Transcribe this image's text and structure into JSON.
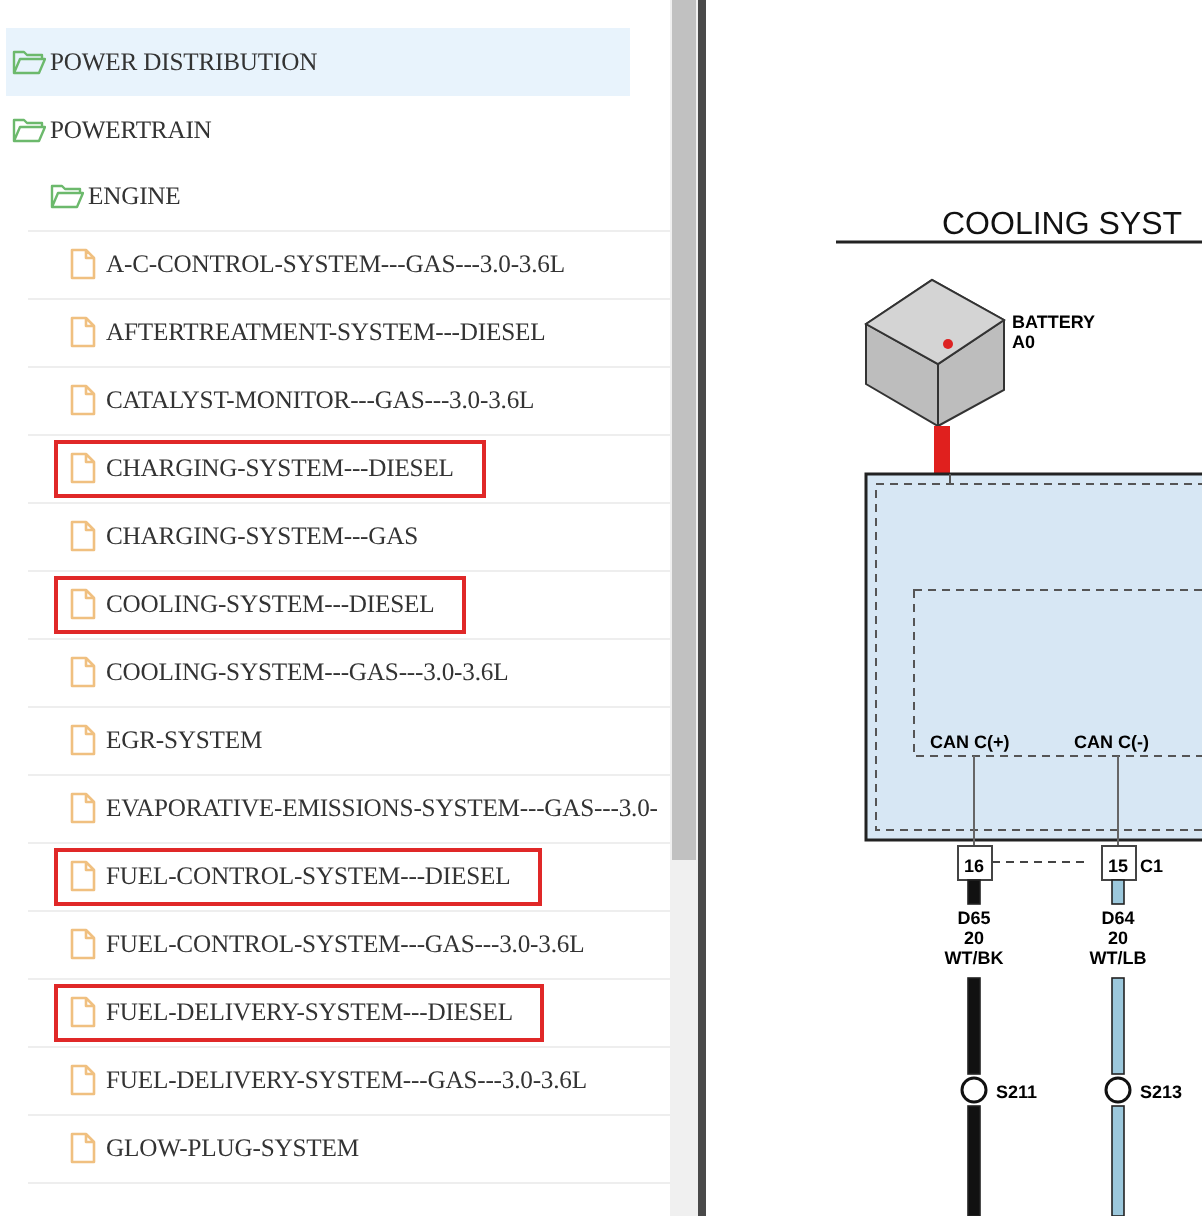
{
  "tree": [
    {
      "kind": "folder",
      "label": "POWER DISTRIBUTION",
      "selected": true
    },
    {
      "kind": "folder",
      "label": "POWERTRAIN",
      "selected": false,
      "children": [
        {
          "kind": "folder",
          "label": "ENGINE",
          "selected": false,
          "children": [
            {
              "kind": "file",
              "label": "A-C-CONTROL-SYSTEM---GAS---3.0-3.6L",
              "selected": false,
              "flagged": false
            },
            {
              "kind": "file",
              "label": "AFTERTREATMENT-SYSTEM---DIESEL",
              "selected": false,
              "flagged": false
            },
            {
              "kind": "file",
              "label": "CATALYST-MONITOR---GAS---3.0-3.6L",
              "selected": false,
              "flagged": false
            },
            {
              "kind": "file",
              "label": "CHARGING-SYSTEM---DIESEL",
              "selected": false,
              "flagged": true
            },
            {
              "kind": "file",
              "label": "CHARGING-SYSTEM---GAS",
              "selected": false,
              "flagged": false
            },
            {
              "kind": "file",
              "label": "COOLING-SYSTEM---DIESEL",
              "selected": false,
              "flagged": true
            },
            {
              "kind": "file",
              "label": "COOLING-SYSTEM---GAS---3.0-3.6L",
              "selected": false,
              "flagged": false
            },
            {
              "kind": "file",
              "label": "EGR-SYSTEM",
              "selected": false,
              "flagged": false
            },
            {
              "kind": "file",
              "label": "EVAPORATIVE-EMISSIONS-SYSTEM---GAS---3.0-",
              "selected": false,
              "flagged": false
            },
            {
              "kind": "file",
              "label": "FUEL-CONTROL-SYSTEM---DIESEL",
              "selected": false,
              "flagged": true
            },
            {
              "kind": "file",
              "label": "FUEL-CONTROL-SYSTEM---GAS---3.0-3.6L",
              "selected": false,
              "flagged": false
            },
            {
              "kind": "file",
              "label": "FUEL-DELIVERY-SYSTEM---DIESEL",
              "selected": false,
              "flagged": true
            },
            {
              "kind": "file",
              "label": "FUEL-DELIVERY-SYSTEM---GAS---3.0-3.6L",
              "selected": false,
              "flagged": false
            },
            {
              "kind": "file",
              "label": "GLOW-PLUG-SYSTEM",
              "selected": false,
              "flagged": false
            }
          ]
        }
      ]
    }
  ],
  "diagram": {
    "title": "COOLING SYST",
    "battery": {
      "name": "BATTERY",
      "code": "A0"
    },
    "pins": [
      {
        "signal": "CAN C(+)",
        "pin": "16",
        "circuit": "D65",
        "gauge": "20",
        "wire_color": "WT/BK",
        "splice": "S211",
        "kind": "dark"
      },
      {
        "signal": "CAN C(-)",
        "pin": "15",
        "circuit": "D64",
        "gauge": "20",
        "wire_color": "WT/LB",
        "splice": "S213",
        "kind": "light"
      }
    ],
    "connector": "C1"
  }
}
